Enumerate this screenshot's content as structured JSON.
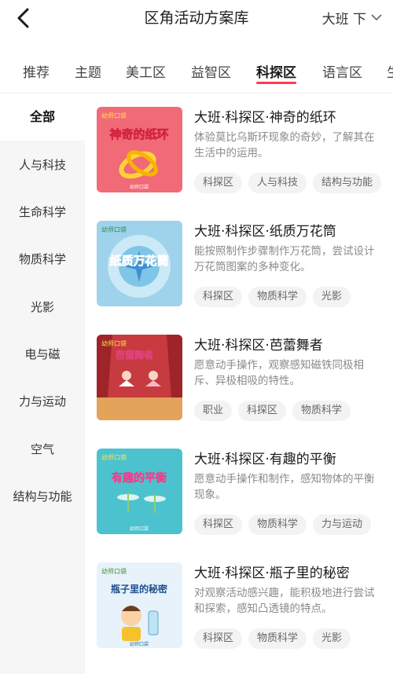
{
  "header": {
    "title": "区角活动方案库",
    "grade": "大班 下"
  },
  "tabs": [
    {
      "label": "推荐"
    },
    {
      "label": "主题"
    },
    {
      "label": "美工区"
    },
    {
      "label": "益智区"
    },
    {
      "label": "科探区",
      "active": true
    },
    {
      "label": "语言区"
    },
    {
      "label": "生"
    }
  ],
  "sidebar": {
    "items": [
      {
        "label": "全部",
        "active": true
      },
      {
        "label": "人与科技"
      },
      {
        "label": "生命科学"
      },
      {
        "label": "物质科学"
      },
      {
        "label": "光影"
      },
      {
        "label": "电与磁"
      },
      {
        "label": "力与运动"
      },
      {
        "label": "空气"
      },
      {
        "label": "结构与功能"
      }
    ]
  },
  "cards": [
    {
      "title": "大班·科探区·神奇的纸环",
      "desc": "体验莫比乌斯环现象的奇妙，了解其在生活中的运用。",
      "tags": [
        "科探区",
        "人与科技",
        "结构与功能"
      ],
      "thumb_text": "神奇的纸环",
      "thumb_brand": "幼师口袋",
      "thumb_footer": "幼师口袋",
      "thumb_bg": "#f06a78"
    },
    {
      "title": "大班·科探区·纸质万花筒",
      "desc": "能按照制作步骤制作万花筒，尝试设计万花筒图案的多种变化。",
      "tags": [
        "科探区",
        "物质科学",
        "光影"
      ],
      "thumb_text": "纸质万花筒",
      "thumb_brand": "幼师口袋",
      "thumb_footer": "",
      "thumb_bg": "#9fd3ec"
    },
    {
      "title": "大班·科探区·芭蕾舞者",
      "desc": "愿意动手操作，观察感知磁铁同极相斥、异极相吸的特性。",
      "tags": [
        "职业",
        "科探区",
        "物质科学"
      ],
      "thumb_text": "芭蕾舞者",
      "thumb_brand": "幼师口袋",
      "thumb_footer": "",
      "thumb_bg": "#c73a3f"
    },
    {
      "title": "大班·科探区·有趣的平衡",
      "desc": "愿意动手操作和制作，感知物体的平衡现象。",
      "tags": [
        "科探区",
        "物质科学",
        "力与运动"
      ],
      "thumb_text": "有趣的平衡",
      "thumb_brand": "幼师口袋",
      "thumb_footer": "幼师口袋",
      "thumb_bg": "#4cc2cf"
    },
    {
      "title": "大班·科探区·瓶子里的秘密",
      "desc": "对观察活动感兴趣，能积极地进行尝试和探索，感知凸透镜的特点。",
      "tags": [
        "科探区",
        "物质科学",
        "光影"
      ],
      "thumb_text": "瓶子里的秘密",
      "thumb_brand": "幼师口袋",
      "thumb_footer": "幼师口袋",
      "thumb_bg": "#e7f2fa"
    }
  ]
}
